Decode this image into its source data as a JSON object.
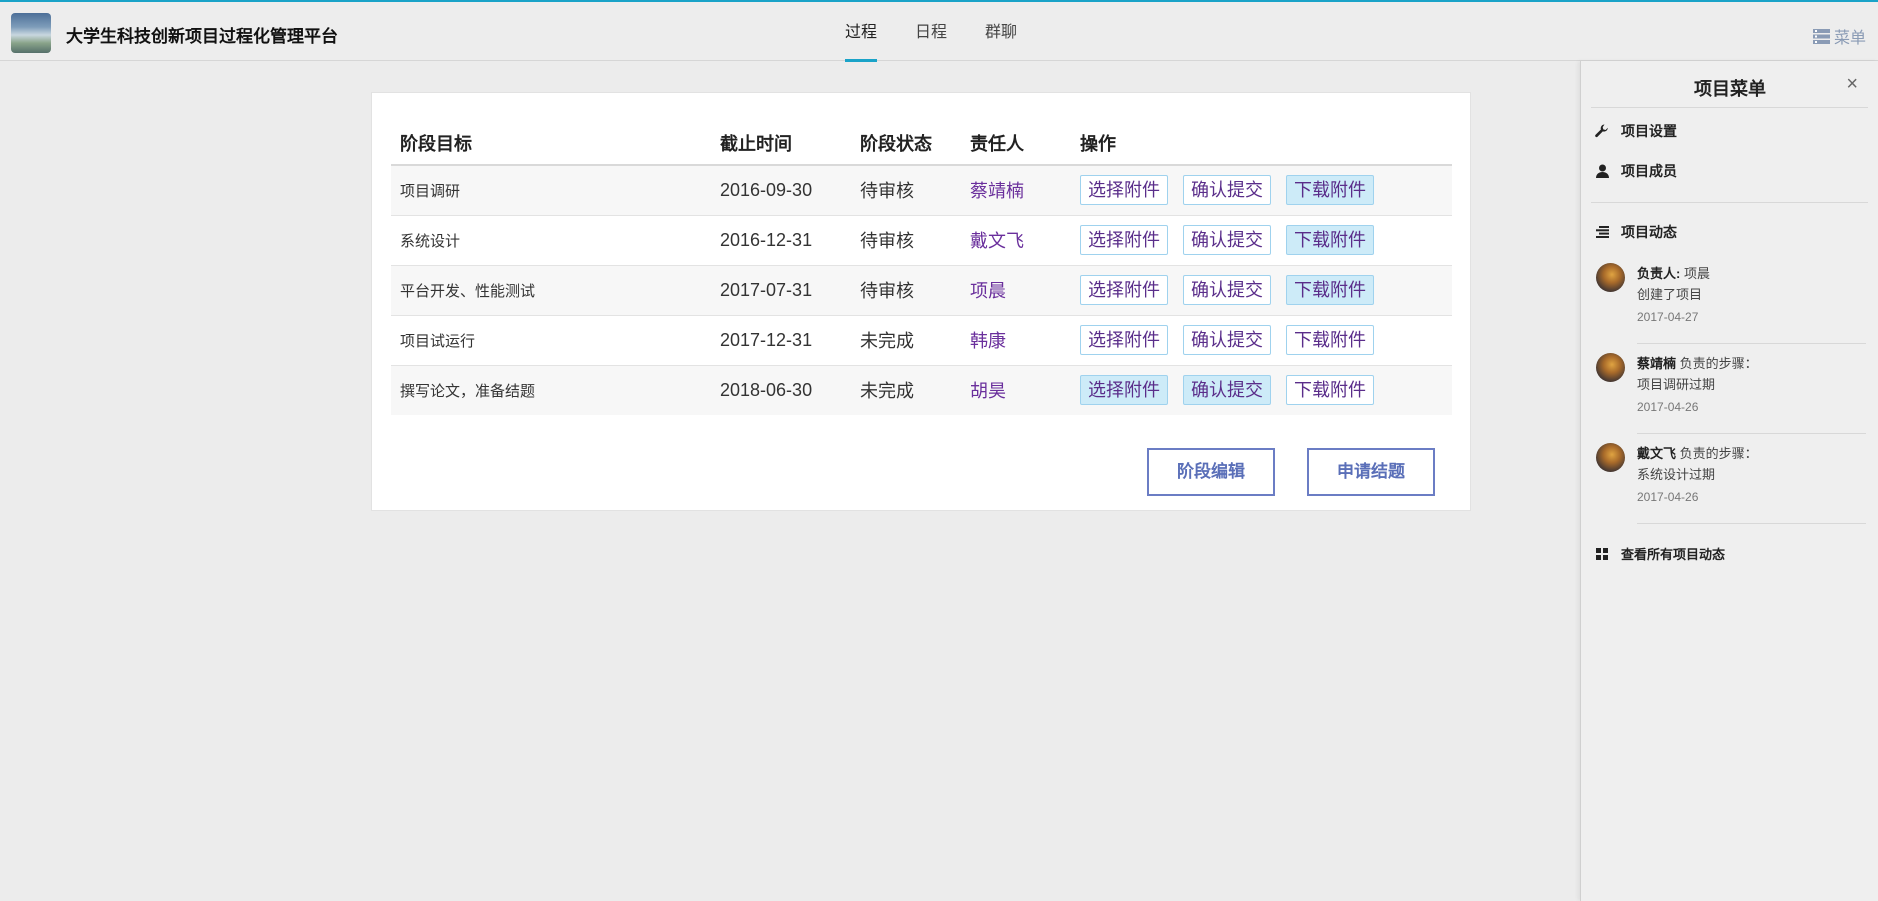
{
  "app": {
    "title": "大学生科技创新项目过程化管理平台"
  },
  "nav": {
    "tabs": [
      {
        "label": "过程",
        "active": true
      },
      {
        "label": "日程",
        "active": false
      },
      {
        "label": "群聊",
        "active": false
      }
    ],
    "menu_label": "菜单"
  },
  "table": {
    "headers": [
      "阶段目标",
      "截止时间",
      "阶段状态",
      "责任人",
      "操作"
    ],
    "rows": [
      {
        "goal": "项目调研",
        "deadline": "2016-09-30",
        "status": "待审核",
        "owner": "蔡靖楠",
        "actions": [
          "选择附件",
          "确认提交",
          "下载附件"
        ]
      },
      {
        "goal": "系统设计",
        "deadline": "2016-12-31",
        "status": "待审核",
        "owner": "戴文飞",
        "actions": [
          "选择附件",
          "确认提交",
          "下载附件"
        ]
      },
      {
        "goal": "平台开发、性能测试",
        "deadline": "2017-07-31",
        "status": "待审核",
        "owner": "项晨",
        "actions": [
          "选择附件",
          "确认提交",
          "下载附件"
        ]
      },
      {
        "goal": "项目试运行",
        "deadline": "2017-12-31",
        "status": "未完成",
        "owner": "韩康",
        "actions": [
          "选择附件",
          "确认提交",
          "下载附件"
        ]
      },
      {
        "goal": "撰写论文，准备结题",
        "deadline": "2018-06-30",
        "status": "未完成",
        "owner": "胡昊",
        "actions": [
          "选择附件",
          "确认提交",
          "下载附件"
        ]
      }
    ]
  },
  "buttons": {
    "edit_stage": "阶段编辑",
    "apply_close": "申请结题"
  },
  "side_menu": {
    "title": "项目菜单",
    "close": "×",
    "items": [
      {
        "label": "项目设置",
        "icon": "wrench-icon"
      },
      {
        "label": "项目成员",
        "icon": "user-icon"
      },
      {
        "label": "项目动态",
        "icon": "list-icon"
      }
    ],
    "activities": [
      {
        "name": "负责人:",
        "name_suffix": " 项晨",
        "desc": "创建了项目",
        "date": "2017-04-27"
      },
      {
        "name": "蔡靖楠",
        "name_suffix": " 负责的步骤：",
        "desc": "项目调研过期",
        "date": "2017-04-26"
      },
      {
        "name": "戴文飞",
        "name_suffix": " 负责的步骤：",
        "desc": "系统设计过期",
        "date": "2017-04-26"
      }
    ],
    "view_all": "查看所有项目动态"
  },
  "colors": {
    "accent": "#1aa3c8",
    "owner_purple": "#6a2f9c",
    "button_border": "#6b7dc4"
  }
}
